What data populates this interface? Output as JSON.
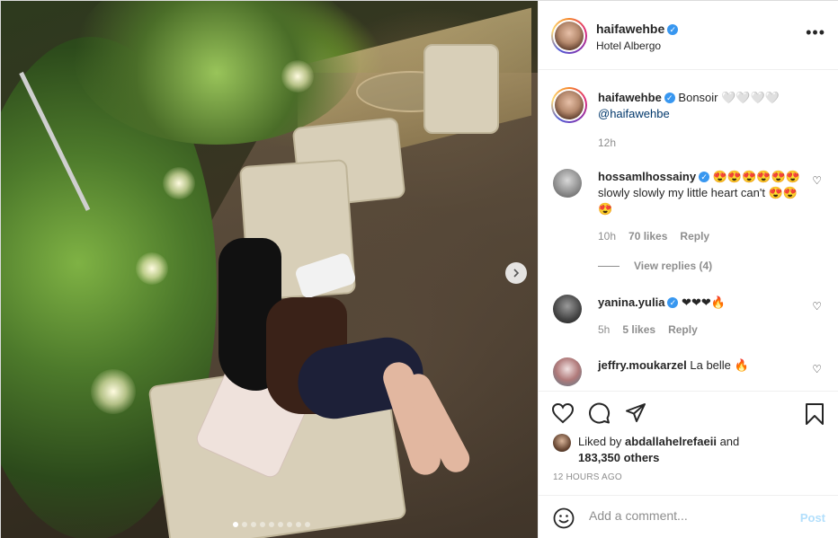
{
  "header": {
    "username": "haifawehbe",
    "location": "Hotel Albergo",
    "more_label": "•••"
  },
  "caption": {
    "username": "haifawehbe",
    "text": "Bonsoir 🤍🤍🤍🤍",
    "mention": "@haifawehbe",
    "time": "12h"
  },
  "comments": [
    {
      "username": "hossamlhossainy",
      "verified": true,
      "text": "😍😍😍😍😍😍 slowly slowly my little heart can't 😍😍😍",
      "time": "10h",
      "likes": "70 likes",
      "reply": "Reply",
      "view_replies": "View replies (4)"
    },
    {
      "username": "yanina.yulia",
      "verified": true,
      "text": "❤❤❤🔥",
      "time": "5h",
      "likes": "5 likes",
      "reply": "Reply"
    },
    {
      "username": "jeffry.moukarzel",
      "verified": false,
      "text": "La belle 🔥"
    }
  ],
  "likes": {
    "prefix": "Liked by",
    "user": "abdallahelrefaeii",
    "and": "and",
    "others": "183,350 others"
  },
  "timestamp": "12 HOURS AGO",
  "add_comment": {
    "placeholder": "Add a comment...",
    "post_label": "Post"
  },
  "carousel": {
    "total": 9,
    "current": 1
  },
  "colors": {
    "link": "#00376b",
    "verified": "#3897f0",
    "post_disabled": "#b2dffc",
    "muted": "#8e8e8e"
  }
}
